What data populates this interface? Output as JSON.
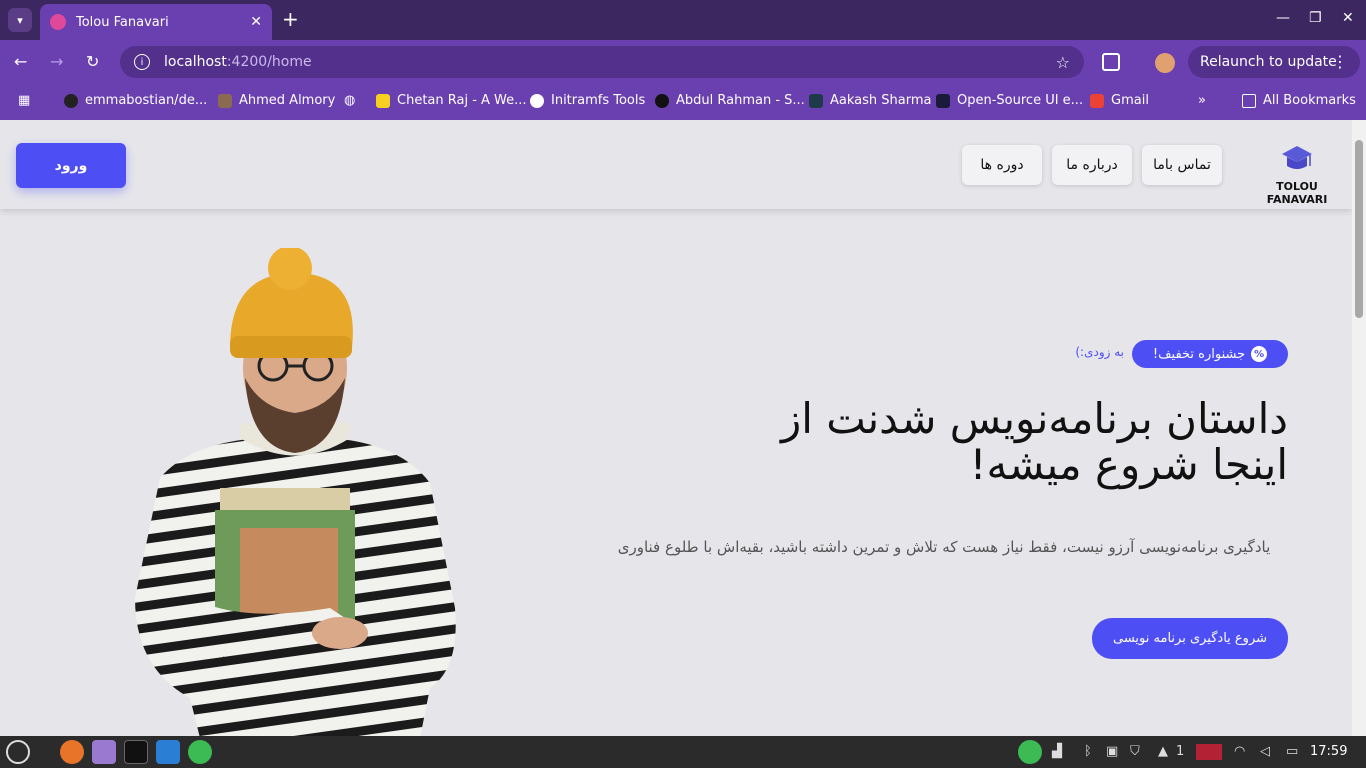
{
  "browser": {
    "tab_title": "Tolou Fanavari",
    "url_host": "localhost",
    "url_path": ":4200/home",
    "relaunch_label": "Relaunch to update",
    "bookmarks": [
      "emmabostian/de...",
      "Ahmed Almory",
      "Chetan Raj - A We...",
      "Initramfs Tools",
      "Abdul Rahman - S...",
      "Aakash Sharma",
      "Open-Source UI e...",
      "Gmail"
    ],
    "all_bookmarks_label": "All Bookmarks"
  },
  "header": {
    "login_label": "ورود",
    "nav": [
      "تماس باما",
      "درباره ما",
      "دوره ها"
    ],
    "logo_text": "TOLOU FANAVARI"
  },
  "hero": {
    "badge_label": "جشنواره تخفیف!",
    "badge_icon": "%",
    "soon_label": "به زودی:)",
    "headline_line1": "داستان برنامه‌نویس شدنت از",
    "headline_line2": "اینجا شروع میشه!",
    "subtext": "یادگیری برنامه‌نویسی آرزو نیست، فقط نیاز هست که تلاش و تمرین داشته باشید، بقیه‌اش با طلوع فناوری",
    "cta_label": "شروع یادگیری برنامه نویسی"
  },
  "taskbar": {
    "time": "17:59",
    "notification_count": "1"
  },
  "colors": {
    "accent": "#4e4ef5",
    "chrome_dark": "#3d2760",
    "chrome": "#6a3fb0",
    "page_bg": "#e6e6ea"
  }
}
